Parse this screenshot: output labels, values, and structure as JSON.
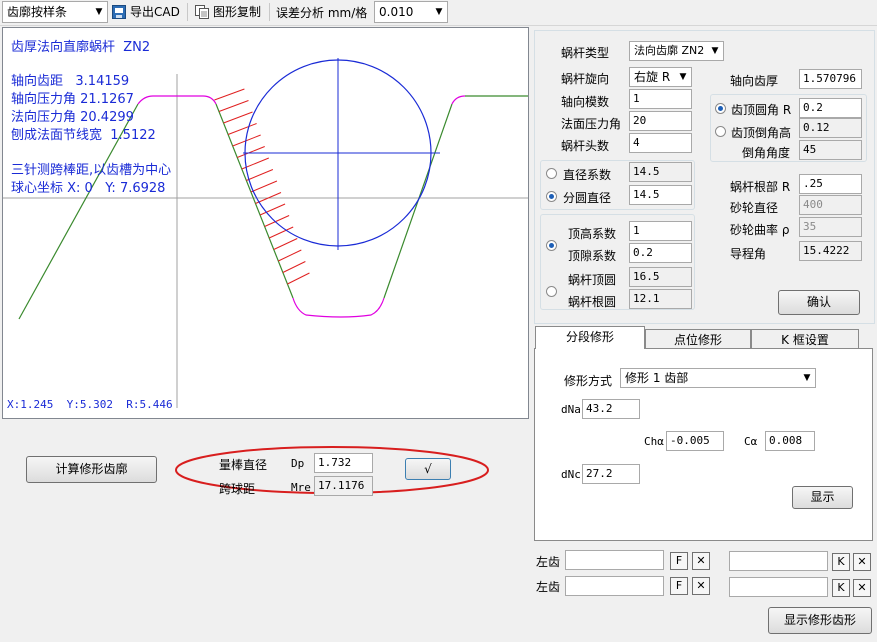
{
  "toolbar": {
    "mode_select": "齿廓按样条",
    "export_cad": "导出CAD",
    "copy_graphic": "图形复制",
    "error_label": "误差分析 mm/格",
    "error_value": "0.010"
  },
  "canvas": {
    "title": "齿厚法向直廓蜗杆  ZN2",
    "axial_pitch": "轴向齿距   3.14159",
    "axial_pressure": "轴向压力角 21.1267",
    "normal_pressure": "法向压力角 20.4299",
    "pitch_line_width": "刨成法面节线宽  1.5122",
    "three_wire": "三针测跨棒距,以齿槽为中心",
    "ball_center": "球心坐标 X: 0   Y: 7.6928",
    "cursor_readout": "X:1.245  Y:5.302  R:5.446"
  },
  "params": {
    "worm_type_label": "蜗杆类型",
    "worm_type_value": "法向齿廓 ZN2",
    "hand_label": "蜗杆旋向",
    "hand_value": "右旋 R",
    "axial_module_label": "轴向模数",
    "axial_module_value": "1",
    "normal_pressure_label": "法面压力角",
    "normal_pressure_value": "20",
    "starts_label": "蜗杆头数",
    "starts_value": "4",
    "axial_thickness_label": "轴向齿厚",
    "axial_thickness_value": "1.570796",
    "tip_radius_label": "齿顶圆角 R",
    "tip_radius_value": "0.2",
    "tip_chamfer_label": "齿顶倒角高",
    "tip_chamfer_value": "0.12",
    "chamfer_angle_label": "倒角角度",
    "chamfer_angle_value": "45",
    "diameter_factor_label": "直径系数",
    "diameter_factor_value": "14.5",
    "pitch_diameter_label": "分圆直径",
    "pitch_diameter_value": "14.5",
    "root_r_label": "蜗杆根部 R",
    "root_r_value": ".25",
    "wheel_diameter_label": "砂轮直径",
    "wheel_diameter_value": "400",
    "wheel_curvature_label": "砂轮曲率 ρ",
    "wheel_curvature_value": "35",
    "addendum_label": "顶高系数",
    "addendum_value": "1",
    "clearance_label": "顶隙系数",
    "clearance_value": "0.2",
    "tip_circle_label": "蜗杆顶圆",
    "tip_circle_value": "16.5",
    "root_circle_label": "蜗杆根圆",
    "root_circle_value": "12.1",
    "lead_angle_label": "导程角",
    "lead_angle_value": "15.4222",
    "confirm_label": "确认"
  },
  "tabs": [
    "分段修形",
    "点位修形",
    "K 框设置"
  ],
  "modify": {
    "method_label": "修形方式",
    "method_value": "修形 1  齿部",
    "dna_label": "dNa",
    "dna_value": "43.2",
    "ch_label": "Chα",
    "ch_value": "-0.005",
    "c_label": "Cα",
    "c_value": "0.008",
    "dnc_label": "dNc",
    "dnc_value": "27.2",
    "show_label": "显示"
  },
  "flanks": {
    "left_label_1": "左齿",
    "left_label_2": "左齿",
    "f_label": "F",
    "x_label": "✕",
    "k_label": "K"
  },
  "show_modified_label": "显示修形齿形",
  "compute_label": "计算修形齿廓",
  "measure": {
    "rod_diameter_label": "量棒直径",
    "dp_label": "Dp",
    "dp_value": "1.732",
    "span_label": "跨球距",
    "mre_label": "Mre",
    "mre_value": "17.1176",
    "check_label": "√"
  },
  "colors": {
    "profile_green": "#3a8a2e",
    "fillet_magenta": "#e000e0",
    "circle_blue": "#1a2bd6",
    "hatch_red": "#e02020",
    "highlight_ellipse": "#d81e1e"
  }
}
